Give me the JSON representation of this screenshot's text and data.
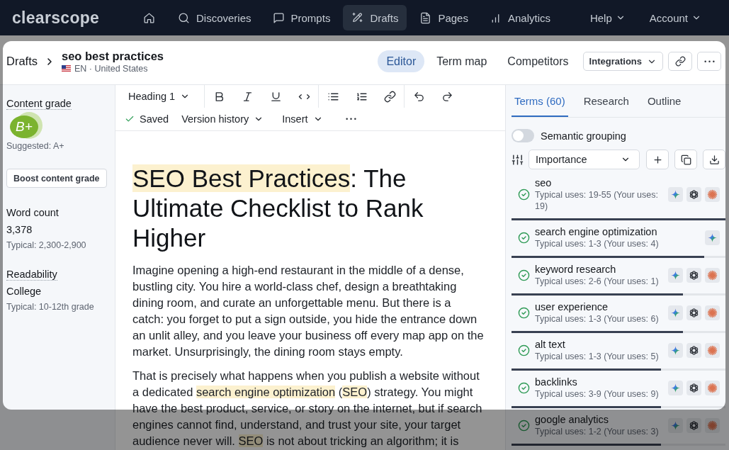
{
  "nav": {
    "logo": "clearscope",
    "items": [
      {
        "label": "Discoveries",
        "selected": false
      },
      {
        "label": "Prompts",
        "selected": false
      },
      {
        "label": "Drafts",
        "selected": true
      },
      {
        "label": "Pages",
        "selected": false
      },
      {
        "label": "Analytics",
        "selected": false
      }
    ],
    "menus": [
      "Help",
      "Account"
    ]
  },
  "header": {
    "breadcrumb": "Drafts",
    "title": "seo best practices",
    "locale": "EN · United States",
    "view_tabs": [
      {
        "label": "Editor",
        "selected": true
      },
      {
        "label": "Term map",
        "selected": false
      },
      {
        "label": "Competitors",
        "selected": false
      }
    ],
    "integrations": "Integrations"
  },
  "sidebar": {
    "grade_label": "Content grade",
    "grade": "B+",
    "suggested": "Suggested: A+",
    "boost_button": "Boost content grade",
    "stats": [
      {
        "label": "Word count",
        "underlined": false,
        "value": "3,378",
        "typical": "Typical: 2,300-2,900"
      },
      {
        "label": "Readability",
        "underlined": true,
        "value": "College",
        "typical": "Typical: 10-12th grade"
      }
    ]
  },
  "toolbar": {
    "block_style": "Heading 1",
    "save_status": "Saved",
    "menus": [
      "Version history",
      "Insert"
    ]
  },
  "document": {
    "title": [
      {
        "text": "SEO Best Practices",
        "highlight": true
      },
      {
        "text": ": The Ultimate Checklist to Rank Higher",
        "highlight": false
      }
    ],
    "paragraphs": [
      {
        "segments": [
          {
            "text": "Imagine opening a high-end restaurant in the middle of a dense, bustling city. You hire a world-class chef, design a breathtaking dining room, and curate an unforgettable menu. But there is a catch: you forget to put a sign outside, you hide the entrance down an unlit alley, and you leave your business off every map app on the market. Unsurprisingly, the dining room stays empty.",
            "highlight": false
          }
        ]
      },
      {
        "segments": [
          {
            "text": "That is precisely what happens when you publish a website without a dedicated ",
            "highlight": false
          },
          {
            "text": "search engine optimization",
            "highlight": true
          },
          {
            "text": " (",
            "highlight": false
          },
          {
            "text": "SEO",
            "highlight": true
          },
          {
            "text": ") strategy. You might have the best product, service, or story on the internet, but if search engines cannot find, understand, and trust your site, your target audience never will. ",
            "highlight": false
          },
          {
            "text": "SEO",
            "highlight": true
          },
          {
            "text": " is not about tricking an algorithm; it is",
            "highlight": false
          }
        ]
      }
    ]
  },
  "terms_panel": {
    "tabs": [
      {
        "label": "Terms (60)",
        "selected": true
      },
      {
        "label": "Research",
        "selected": false
      },
      {
        "label": "Outline",
        "selected": false
      }
    ],
    "grouping": {
      "label": "Semantic grouping",
      "on": false
    },
    "sort": "Importance",
    "terms": [
      {
        "name": "seo",
        "usage": "Typical uses: 19-55 (Your uses: 19)",
        "done": true,
        "level": 1,
        "ai_icons": [
          {
            "kind": "sparkle"
          },
          {
            "kind": "knot"
          },
          {
            "kind": "burst"
          }
        ]
      },
      {
        "name": "search engine optimization",
        "usage": "Typical uses: 1-3 (Your uses: 4)",
        "done": true,
        "level": 0.9,
        "ai_icons": [
          {
            "kind": "sparkle"
          }
        ]
      },
      {
        "name": "keyword research",
        "usage": "Typical uses: 2-6 (Your uses: 1)",
        "done": true,
        "level": 0.8,
        "ai_icons": [
          {
            "kind": "sparkle"
          },
          {
            "kind": "knot"
          },
          {
            "kind": "burst"
          }
        ]
      },
      {
        "name": "user experience",
        "usage": "Typical uses: 1-3 (Your uses: 6)",
        "done": true,
        "level": 0.8,
        "ai_icons": [
          {
            "kind": "sparkle"
          },
          {
            "kind": "knot"
          },
          {
            "kind": "burst"
          }
        ]
      },
      {
        "name": "alt text",
        "usage": "Typical uses: 1-3 (Your uses: 5)",
        "done": true,
        "level": 0.7,
        "ai_icons": [
          {
            "kind": "sparkle"
          },
          {
            "kind": "knot"
          },
          {
            "kind": "burst"
          }
        ]
      },
      {
        "name": "backlinks",
        "usage": "Typical uses: 3-9 (Your uses: 9)",
        "done": true,
        "level": 0.7,
        "ai_icons": [
          {
            "kind": "sparkle"
          },
          {
            "kind": "knot"
          },
          {
            "kind": "burst"
          }
        ]
      },
      {
        "name": "google analytics",
        "usage": "Typical uses: 1-2 (Your uses: 3)",
        "done": true,
        "level": 0.7,
        "ai_icons": [
          {
            "kind": "sparkle"
          },
          {
            "kind": "knot"
          },
          {
            "kind": "burst"
          }
        ]
      }
    ]
  }
}
